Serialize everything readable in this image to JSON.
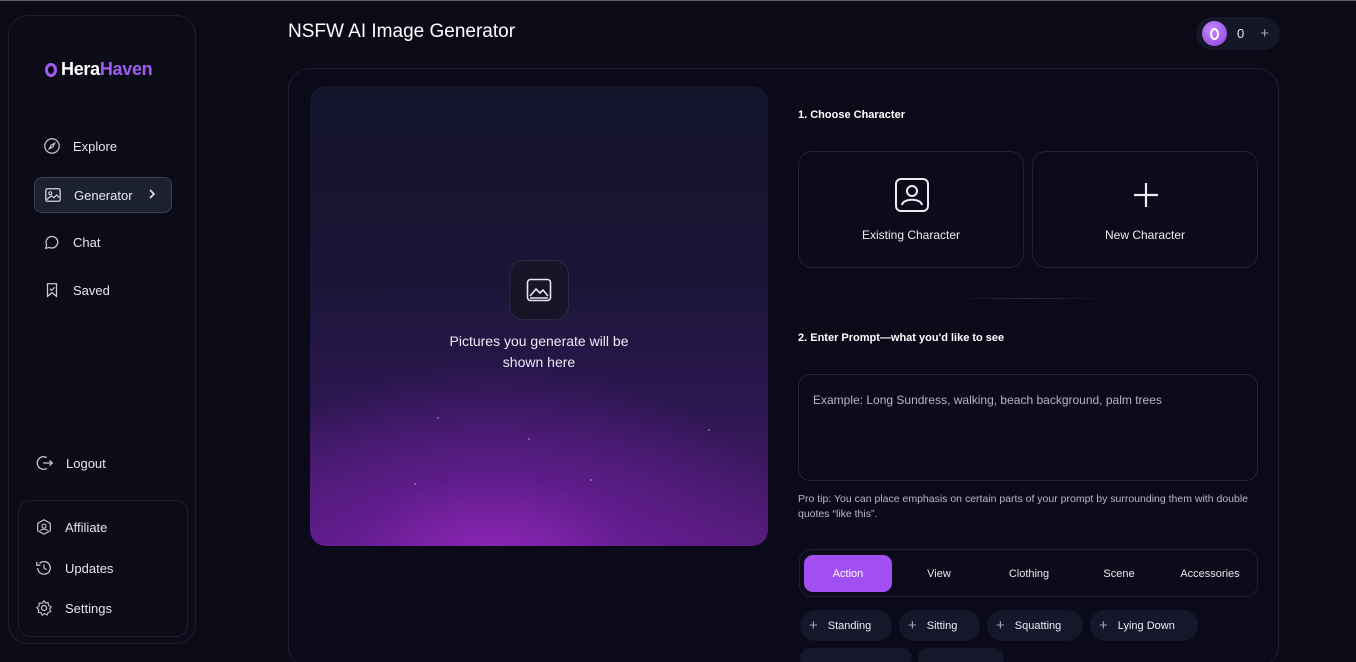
{
  "logo": {
    "part1": "Hera",
    "part2": "Haven"
  },
  "page_title": "NSFW AI Image Generator",
  "credits": {
    "count": "0",
    "add_label": "+"
  },
  "nav": {
    "explore": "Explore",
    "generator": "Generator",
    "chat": "Chat",
    "saved": "Saved",
    "logout": "Logout",
    "affiliate": "Affiliate",
    "updates": "Updates",
    "settings": "Settings"
  },
  "preview": {
    "placeholder": "Pictures you generate will be shown here"
  },
  "step1": {
    "label": "1. Choose Character",
    "existing": "Existing Character",
    "new": "New Character"
  },
  "step2": {
    "label": "2. Enter Prompt—what you'd like to see",
    "placeholder": "Example: Long Sundress, walking, beach background, palm trees",
    "protip": "Pro tip: You can place emphasis on certain parts of your prompt by surrounding them with double quotes “like this”."
  },
  "tabs": [
    "Action",
    "View",
    "Clothing",
    "Scene",
    "Accessories"
  ],
  "chips": [
    "Standing",
    "Sitting",
    "Squatting",
    "Lying Down"
  ],
  "colors": {
    "accent": "#a14ef2",
    "brand": "#a05cf0",
    "background": "#0b0b17"
  }
}
